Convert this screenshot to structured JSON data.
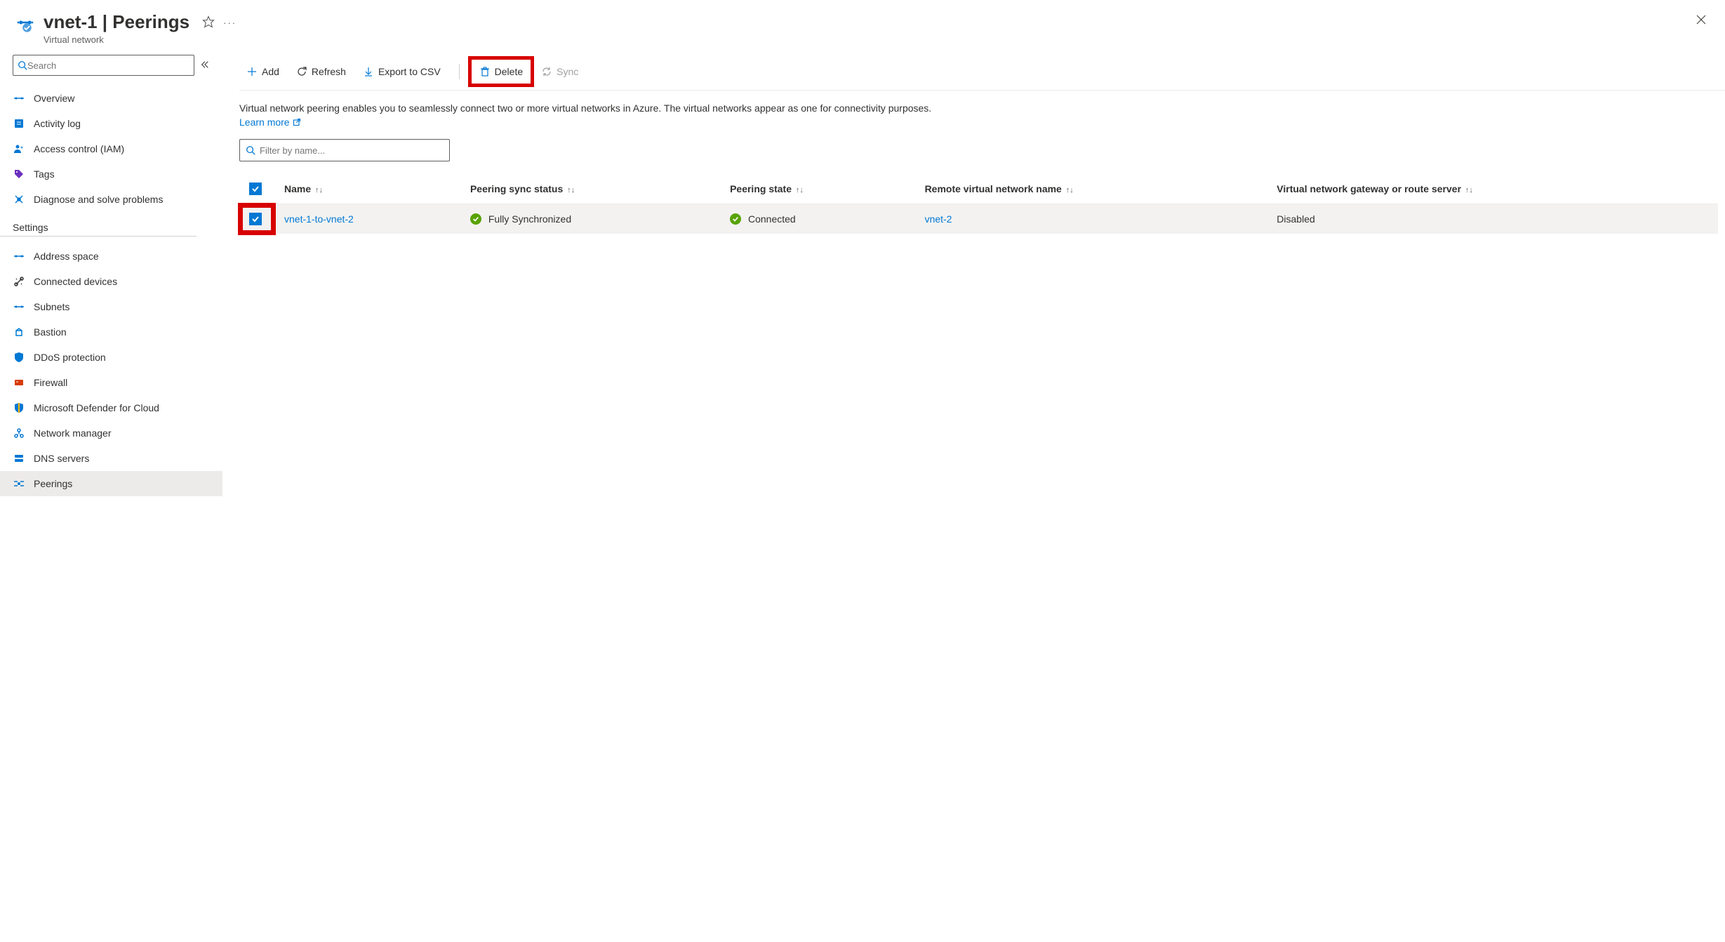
{
  "header": {
    "title": "vnet-1 | Peerings",
    "subtitle": "Virtual network"
  },
  "sidebar": {
    "search_placeholder": "Search",
    "items": [
      {
        "label": "Overview"
      },
      {
        "label": "Activity log"
      },
      {
        "label": "Access control (IAM)"
      },
      {
        "label": "Tags"
      },
      {
        "label": "Diagnose and solve problems"
      }
    ],
    "settings_title": "Settings",
    "settings_items": [
      {
        "label": "Address space"
      },
      {
        "label": "Connected devices"
      },
      {
        "label": "Subnets"
      },
      {
        "label": "Bastion"
      },
      {
        "label": "DDoS protection"
      },
      {
        "label": "Firewall"
      },
      {
        "label": "Microsoft Defender for Cloud"
      },
      {
        "label": "Network manager"
      },
      {
        "label": "DNS servers"
      },
      {
        "label": "Peerings"
      }
    ]
  },
  "toolbar": {
    "add": "Add",
    "refresh": "Refresh",
    "export": "Export to CSV",
    "delete": "Delete",
    "sync": "Sync"
  },
  "description": {
    "text": "Virtual network peering enables you to seamlessly connect two or more virtual networks in Azure. The virtual networks appear as one for connectivity purposes.",
    "learn_more": "Learn more"
  },
  "filter": {
    "placeholder": "Filter by name..."
  },
  "table": {
    "columns": {
      "name": "Name",
      "sync_status": "Peering sync status",
      "state": "Peering state",
      "remote": "Remote virtual network name",
      "gateway": "Virtual network gateway or route server"
    },
    "rows": [
      {
        "name": "vnet-1-to-vnet-2",
        "sync_status": "Fully Synchronized",
        "state": "Connected",
        "remote": "vnet-2",
        "gateway": "Disabled"
      }
    ]
  }
}
